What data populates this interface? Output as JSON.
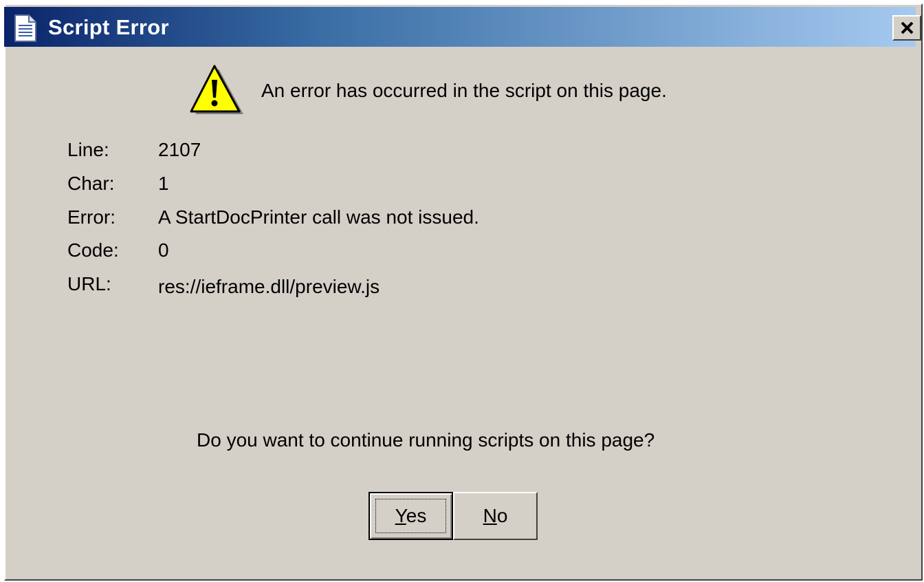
{
  "window": {
    "title": "Script Error",
    "close_symbol": "×"
  },
  "icons": {
    "title_icon": "document-icon",
    "main_icon": "warning-icon",
    "close_icon": "close-icon"
  },
  "message": "An error has occurred in the script on this page.",
  "details": [
    {
      "label": "Line:",
      "value": "2107"
    },
    {
      "label": "Char:",
      "value": "1"
    },
    {
      "label": "Error:",
      "value": "A StartDocPrinter call was not issued."
    },
    {
      "label": "Code:",
      "value": "0"
    },
    {
      "label": "URL:",
      "value": "res://ieframe.dll/preview.js"
    }
  ],
  "question": "Do you want to continue running scripts on this page?",
  "buttons": {
    "yes": {
      "mnemonic": "Y",
      "rest": "es"
    },
    "no": {
      "mnemonic": "N",
      "rest": "o"
    }
  },
  "colors": {
    "dialog_background": "#d4d0c8",
    "titlebar_start": "#0a246a",
    "titlebar_end": "#a6caf0",
    "warning_yellow": "#ffff00"
  }
}
